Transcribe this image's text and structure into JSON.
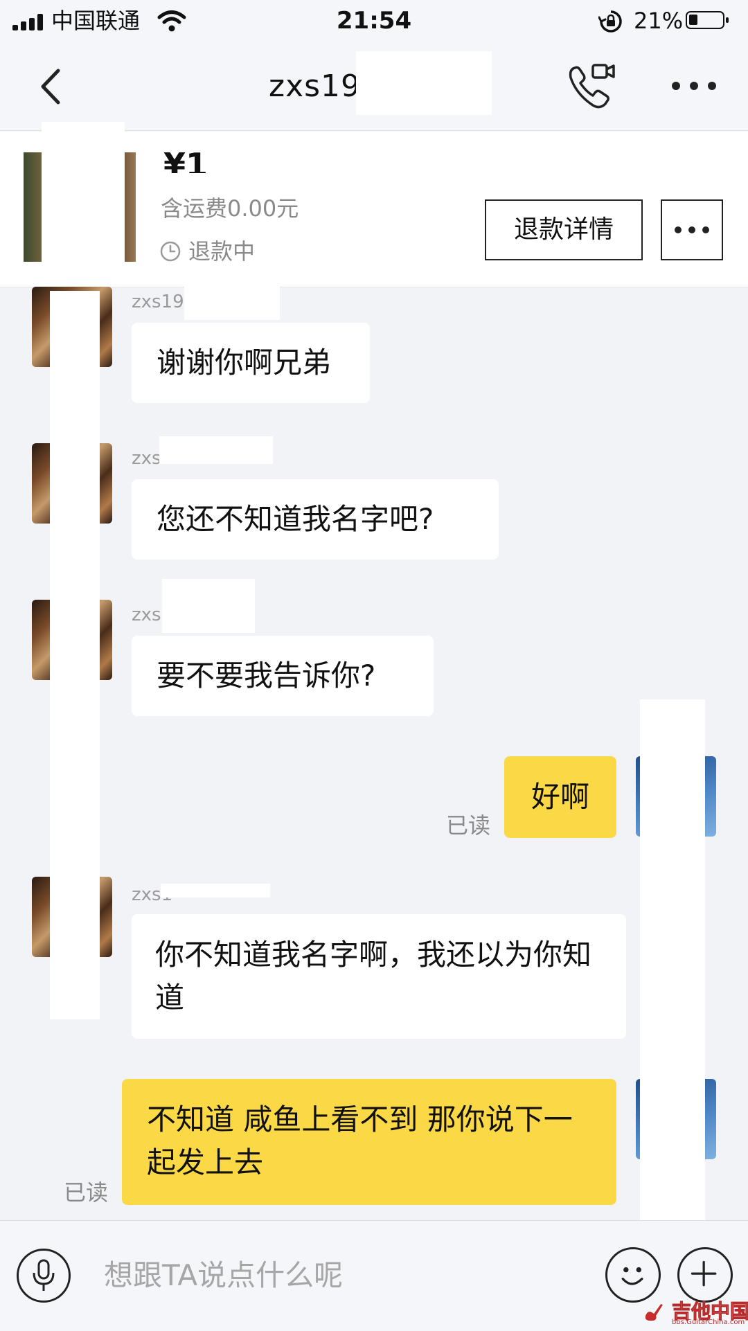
{
  "status_bar": {
    "carrier": "中国联通",
    "time": "21:54",
    "battery": "21%"
  },
  "nav": {
    "title": "zxs19"
  },
  "product": {
    "price": "¥1",
    "shipping": "含运费0.00元",
    "status": "退款中",
    "refund_button": "退款详情"
  },
  "messages": [
    {
      "side": "left",
      "sender": "zxs199",
      "text": "谢谢你啊兄弟"
    },
    {
      "side": "left",
      "sender": "zxs",
      "text": "您还不知道我名字吧?"
    },
    {
      "side": "left",
      "sender": "zxs",
      "text": "要不要我告诉你?"
    },
    {
      "side": "right",
      "text": "好啊",
      "read": "已读"
    },
    {
      "side": "left",
      "sender": "zxs1",
      "text": "你不知道我名字啊，我还以为你知道"
    },
    {
      "side": "right",
      "text": "不知道 咸鱼上看不到 那你说下一起发上去",
      "read": "已读"
    }
  ],
  "input": {
    "placeholder": "想跟TA说点什么呢"
  },
  "watermark": {
    "main": "吉他中国",
    "sub": "bbs.GuitarChina.com"
  },
  "colors": {
    "accent": "#fbd846",
    "background": "#f2f3f6"
  }
}
